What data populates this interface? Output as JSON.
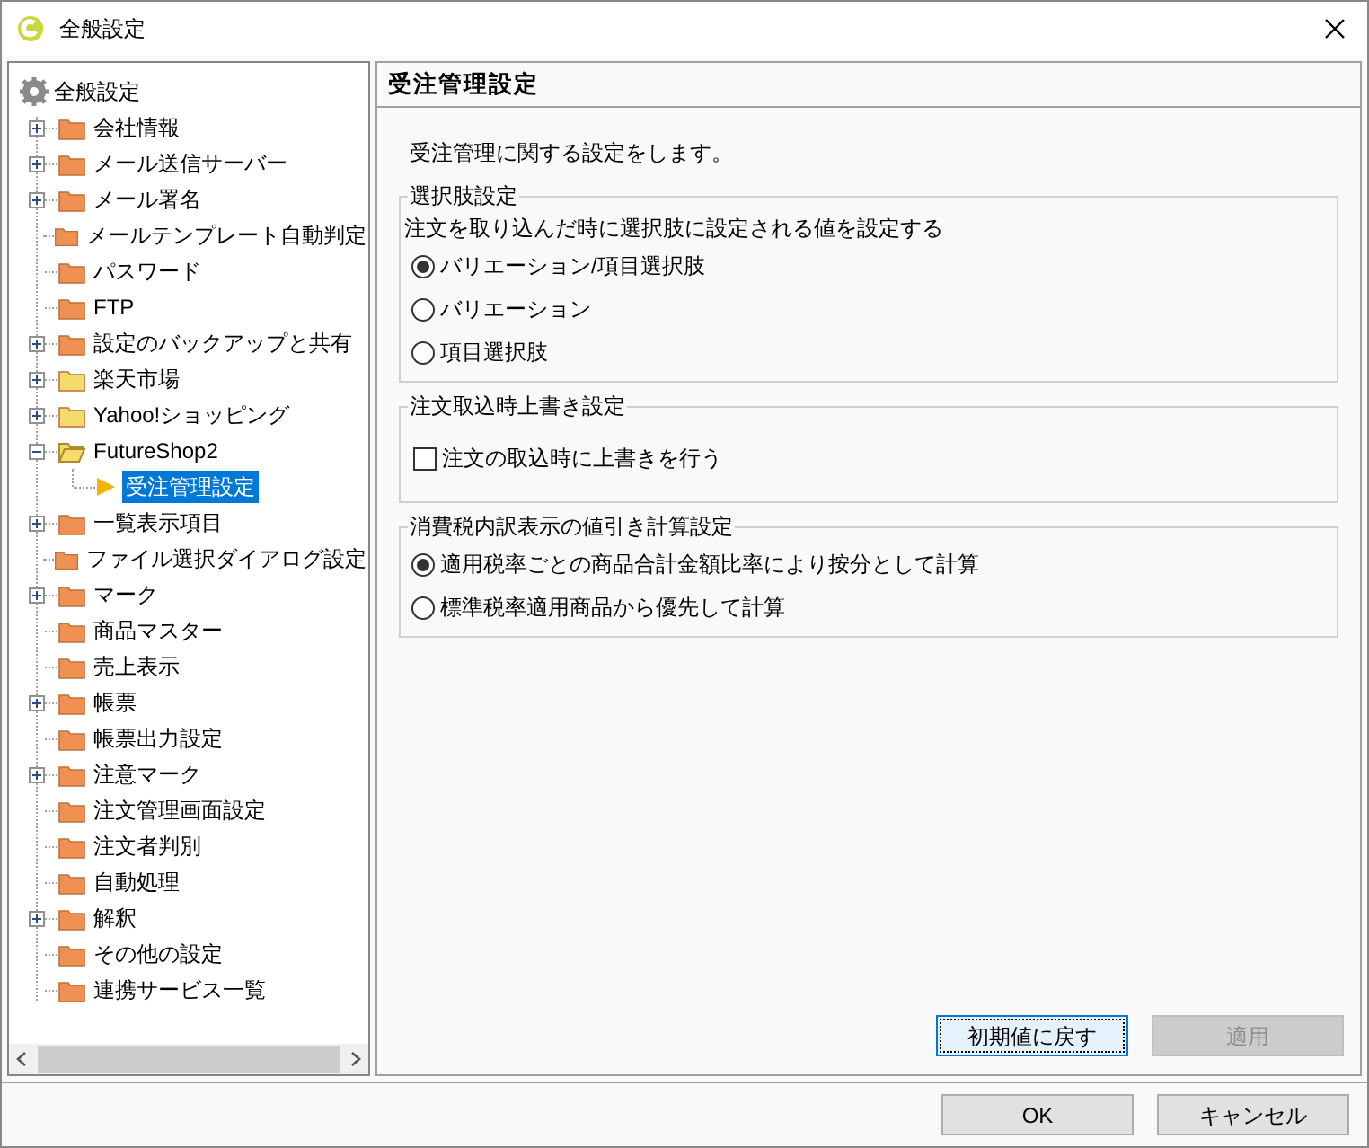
{
  "window": {
    "title": "全般設定"
  },
  "tree": {
    "label": "全般設定",
    "children": [
      {
        "label": "会社情報",
        "kind": "branch",
        "expanded": false,
        "color": "#ee9152",
        "selected": false
      },
      {
        "label": "メール送信サーバー",
        "kind": "branch",
        "expanded": false,
        "color": "#ee9152",
        "selected": false
      },
      {
        "label": "メール署名",
        "kind": "branch",
        "expanded": false,
        "color": "#ee9152",
        "selected": false
      },
      {
        "label": "メールテンプレート自動判定",
        "kind": "leaf",
        "color": "#ee9152",
        "selected": false
      },
      {
        "label": "パスワード",
        "kind": "leaf",
        "color": "#ee9152",
        "selected": false
      },
      {
        "label": "FTP",
        "kind": "leaf",
        "color": "#ee9152",
        "selected": false
      },
      {
        "label": "設定のバックアップと共有",
        "kind": "branch",
        "expanded": false,
        "color": "#ee9152",
        "selected": false
      },
      {
        "label": "楽天市場",
        "kind": "branch",
        "expanded": false,
        "color": "#f3dc6a",
        "selected": false
      },
      {
        "label": "Yahoo!ショッピング",
        "kind": "branch",
        "expanded": false,
        "color": "#f3dc6a",
        "selected": false
      },
      {
        "label": "FutureShop2",
        "kind": "branch",
        "expanded": true,
        "color": "#f3dc6a",
        "selected": false,
        "children": [
          {
            "label": "受注管理設定",
            "kind": "setting",
            "selected": true
          }
        ]
      },
      {
        "label": "一覧表示項目",
        "kind": "branch",
        "expanded": false,
        "color": "#ee9152",
        "selected": false
      },
      {
        "label": "ファイル選択ダイアログ設定",
        "kind": "leaf",
        "color": "#ee9152",
        "selected": false
      },
      {
        "label": "マーク",
        "kind": "branch",
        "expanded": false,
        "color": "#ee9152",
        "selected": false
      },
      {
        "label": "商品マスター",
        "kind": "leaf",
        "color": "#ee9152",
        "selected": false
      },
      {
        "label": "売上表示",
        "kind": "leaf",
        "color": "#ee9152",
        "selected": false
      },
      {
        "label": "帳票",
        "kind": "branch",
        "expanded": false,
        "color": "#ee9152",
        "selected": false
      },
      {
        "label": "帳票出力設定",
        "kind": "leaf",
        "color": "#ee9152",
        "selected": false
      },
      {
        "label": "注意マーク",
        "kind": "branch",
        "expanded": false,
        "color": "#ee9152",
        "selected": false
      },
      {
        "label": "注文管理画面設定",
        "kind": "leaf",
        "color": "#ee9152",
        "selected": false
      },
      {
        "label": "注文者判別",
        "kind": "leaf",
        "color": "#ee9152",
        "selected": false
      },
      {
        "label": "自動処理",
        "kind": "leaf",
        "color": "#ee9152",
        "selected": false
      },
      {
        "label": "解釈",
        "kind": "branch",
        "expanded": false,
        "color": "#ee9152",
        "selected": false
      },
      {
        "label": "その他の設定",
        "kind": "leaf",
        "color": "#ee9152",
        "selected": false
      },
      {
        "label": "連携サービス一覧",
        "kind": "leaf",
        "color": "#ee9152",
        "selected": false
      }
    ]
  },
  "panel": {
    "title": "受注管理設定",
    "description": "受注管理に関する設定をします。",
    "groups": [
      {
        "legend": "選択肢設定",
        "kind": "radio",
        "note": "注文を取り込んだ時に選択肢に設定される値を設定する",
        "options": [
          {
            "label": "バリエーション/項目選択肢",
            "selected": true
          },
          {
            "label": "バリエーション",
            "selected": false
          },
          {
            "label": "項目選択肢",
            "selected": false
          }
        ]
      },
      {
        "legend": "注文取込時上書き設定",
        "kind": "checkbox",
        "options": [
          {
            "label": "注文の取込時に上書きを行う",
            "checked": false
          }
        ]
      },
      {
        "legend": "消費税内訳表示の値引き計算設定",
        "kind": "radio",
        "options": [
          {
            "label": "適用税率ごとの商品合計金額比率により按分として計算",
            "selected": true
          },
          {
            "label": "標準税率適用商品から優先して計算",
            "selected": false
          }
        ]
      }
    ],
    "buttons": [
      {
        "label": "初期値に戻す",
        "disabled": false,
        "focused": true
      },
      {
        "label": "適用",
        "disabled": true,
        "focused": false
      }
    ]
  },
  "footer_buttons": [
    "OK",
    "キャンセル"
  ]
}
